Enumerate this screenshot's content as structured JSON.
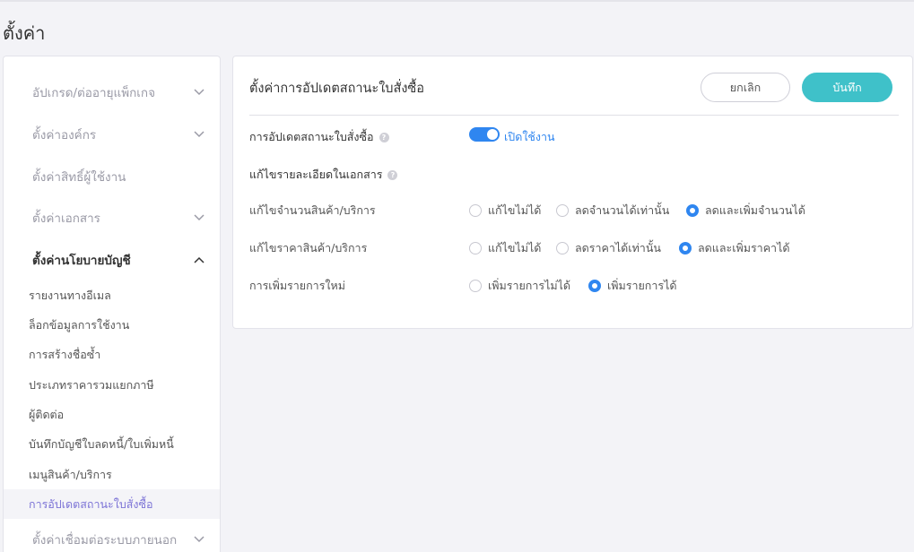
{
  "page": {
    "title": "ตั้งค่า"
  },
  "sidebar": {
    "sections": [
      {
        "label": "อัปเกรด/ต่ออายุแพ็กเกจ",
        "chevron": "down"
      },
      {
        "label": "ตั้งค่าองค์กร",
        "chevron": "down"
      },
      {
        "label": "ตั้งค่าสิทธิ์ผู้ใช้งาน",
        "chevron": "none"
      },
      {
        "label": "ตั้งค่าเอกสาร",
        "chevron": "down"
      },
      {
        "label": "ตั้งค่านโยบายบัญชี",
        "chevron": "up"
      }
    ],
    "sub_items": [
      {
        "label": "รายงานทางอีเมล"
      },
      {
        "label": "ล็อกข้อมูลการใช้งาน"
      },
      {
        "label": "การสร้างชื่อซ้ำ"
      },
      {
        "label": "ประเภทราคารวมแยกภาษี"
      },
      {
        "label": "ผู้ติดต่อ"
      },
      {
        "label": "บันทึกบัญชีใบลดหนี้/ใบเพิ่มหนี้"
      },
      {
        "label": "เมนูสินค้า/บริการ"
      },
      {
        "label": "การอัปเดตสถานะใบสั่งซื้อ"
      }
    ],
    "bottom_section": {
      "label": "ตั้งค่าเชื่อมต่อระบบภายนอก",
      "chevron": "down"
    }
  },
  "card": {
    "title": "ตั้งค่าการอัปเดตสถานะใบสั่งซื้อ",
    "cancel_label": "ยกเลิก",
    "save_label": "บันทึก",
    "status_row": {
      "label": "การอัปเดตสถานะใบสั่งซื้อ",
      "toggle_label": "เปิดใช้งาน",
      "enabled": true
    },
    "edit_heading": "แก้ไขรายละเอียดในเอกสาร",
    "rows": [
      {
        "label": "แก้ไขจำนวนสินค้า/บริการ",
        "options": [
          "แก้ไขไม่ได้",
          "ลดจำนวนได้เท่านั้น",
          "ลดและเพิ่มจำนวนได้"
        ],
        "selected": 2
      },
      {
        "label": "แก้ไขราคาสินค้า/บริการ",
        "options": [
          "แก้ไขไม่ได้",
          "ลดราคาได้เท่านั้น",
          "ลดและเพิ่มราคาได้"
        ],
        "selected": 2
      },
      {
        "label": "การเพิ่มรายการใหม่",
        "options": [
          "เพิ่มรายการไม่ได้",
          "เพิ่มรายการได้"
        ],
        "selected": 1
      }
    ]
  },
  "colors": {
    "accent_blue": "#2f86f0",
    "save_teal": "#3fc1c9",
    "active_purple": "#7c73d6"
  }
}
